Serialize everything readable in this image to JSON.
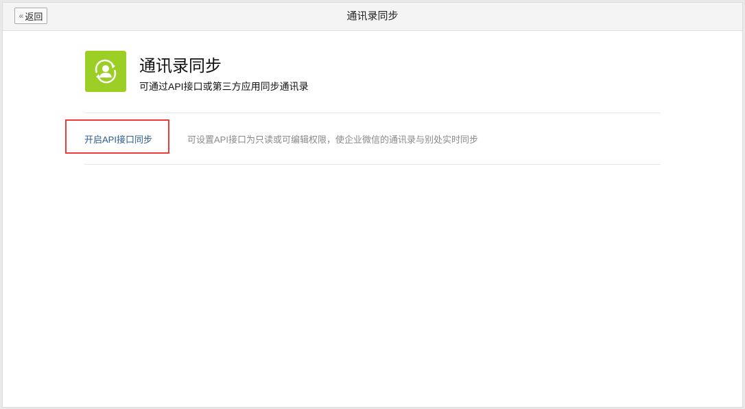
{
  "header": {
    "back_label": "返回",
    "title": "通讯录同步"
  },
  "intro": {
    "icon": "contact-sync-icon",
    "title": "通讯录同步",
    "subtitle": "可通过API接口或第三方应用同步通讯录",
    "accent": "#9ccf26"
  },
  "options": [
    {
      "label": "开启API接口同步",
      "description": "可设置API接口为只读或可编辑权限，使企业微信的通讯录与别处实时同步"
    }
  ]
}
